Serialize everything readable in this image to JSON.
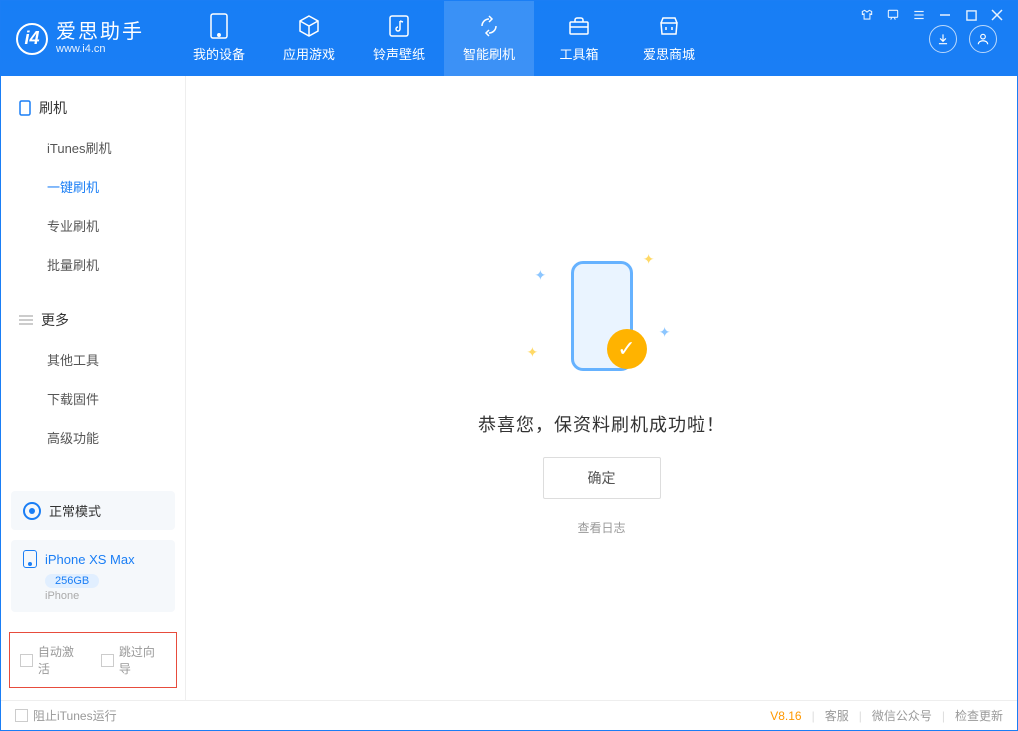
{
  "app": {
    "logo_title": "爱思助手",
    "logo_sub": "www.i4.cn"
  },
  "tabs": [
    {
      "label": "我的设备",
      "icon": "device-icon"
    },
    {
      "label": "应用游戏",
      "icon": "cube-icon"
    },
    {
      "label": "铃声壁纸",
      "icon": "music-icon"
    },
    {
      "label": "智能刷机",
      "icon": "sync-icon"
    },
    {
      "label": "工具箱",
      "icon": "toolbox-icon"
    },
    {
      "label": "爱思商城",
      "icon": "store-icon"
    }
  ],
  "sidebar": {
    "flash_header": "刷机",
    "flash_items": [
      {
        "label": "iTunes刷机"
      },
      {
        "label": "一键刷机"
      },
      {
        "label": "专业刷机"
      },
      {
        "label": "批量刷机"
      }
    ],
    "more_header": "更多",
    "more_items": [
      {
        "label": "其他工具"
      },
      {
        "label": "下载固件"
      },
      {
        "label": "高级功能"
      }
    ]
  },
  "device": {
    "mode": "正常模式",
    "name": "iPhone XS Max",
    "capacity": "256GB",
    "type": "iPhone"
  },
  "bottom_opts": {
    "auto_activate": "自动激活",
    "skip_guide": "跳过向导"
  },
  "main": {
    "success_msg": "恭喜您，保资料刷机成功啦！",
    "ok_label": "确定",
    "view_log": "查看日志"
  },
  "footer": {
    "block_itunes": "阻止iTunes运行",
    "version": "V8.16",
    "support": "客服",
    "wechat": "微信公众号",
    "check_update": "检查更新"
  }
}
